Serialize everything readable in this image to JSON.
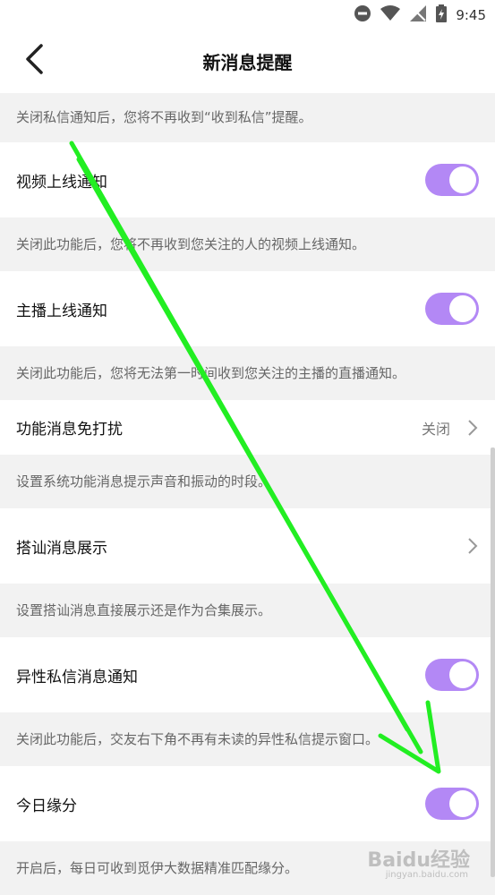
{
  "status_bar": {
    "time": "9:45",
    "icons": [
      "do-not-disturb-icon",
      "wifi-icon",
      "no-signal-icon",
      "battery-charging-icon"
    ]
  },
  "header": {
    "title": "新消息提醒",
    "back_icon": "chevron-left-icon"
  },
  "sections": {
    "private_message_desc": "关闭私信通知后，您将不再收到“收到私信”提醒。",
    "video_online": {
      "label": "视频上线通知",
      "toggle_on": true,
      "desc": "关闭此功能后，您将不再收到您关注的人的视频上线通知。"
    },
    "host_online": {
      "label": "主播上线通知",
      "toggle_on": true,
      "desc": "关闭此功能后，您将无法第一时间收到您关注的主播的直播通知。"
    },
    "dnd": {
      "label": "功能消息免打扰",
      "value": "关闭",
      "desc": "设置系统功能消息提示声音和振动的时段。"
    },
    "chat_display": {
      "label": "搭讪消息展示",
      "desc": "设置搭讪消息直接展示还是作为合集展示。"
    },
    "opposite_sex": {
      "label": "异性私信消息通知",
      "toggle_on": true,
      "desc": "关闭此功能后，交友右下角不再有未读的异性私信提示窗口。"
    },
    "today_fate": {
      "label": "今日缘分",
      "toggle_on": true,
      "desc": "开启后，每日可收到觅伊大数据精准匹配缘分。"
    }
  },
  "colors": {
    "toggle_on": "#b388f5",
    "annotation_arrow": "#22ee22"
  },
  "watermark": {
    "text": "Baidu经验",
    "sub": "jingyan.baidu.com"
  }
}
